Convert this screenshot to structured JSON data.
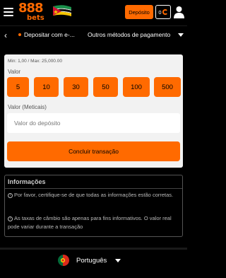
{
  "header": {
    "logo_main": "888",
    "logo_sub": "bets",
    "deposit_label": "Depósito",
    "balance": "0"
  },
  "subnav": {
    "back_symbol": "‹",
    "current": "Depositar com e-...",
    "other": "Outros métodos de pagamento"
  },
  "form": {
    "minmax": "Min: 1,00 / Max: 25,000.00",
    "valor_label": "Valor",
    "amounts": [
      "5",
      "10",
      "30",
      "50",
      "100",
      "500"
    ],
    "meticais_label": "Valor (Meticais)",
    "input_placeholder": "Valor do depósito",
    "input_value": "",
    "submit_label": "Concluir transação"
  },
  "info": {
    "title": "Informações",
    "line1": "Por favor, certifique-se de que todas as informações estão corretas.",
    "line2": "As taxas de câmbio são apenas para fins informativos. O valor real pode variar durante a transação"
  },
  "footer": {
    "language": "Português"
  },
  "colors": {
    "accent": "#ff6a00",
    "background": "#000000",
    "panel": "#f2f2f2"
  },
  "icons": [
    "menu-icon",
    "mozambique-flag-icon",
    "refresh-icon",
    "user-icon",
    "back-icon",
    "chevron-down-icon",
    "info-icon",
    "portugal-flag-icon"
  ]
}
